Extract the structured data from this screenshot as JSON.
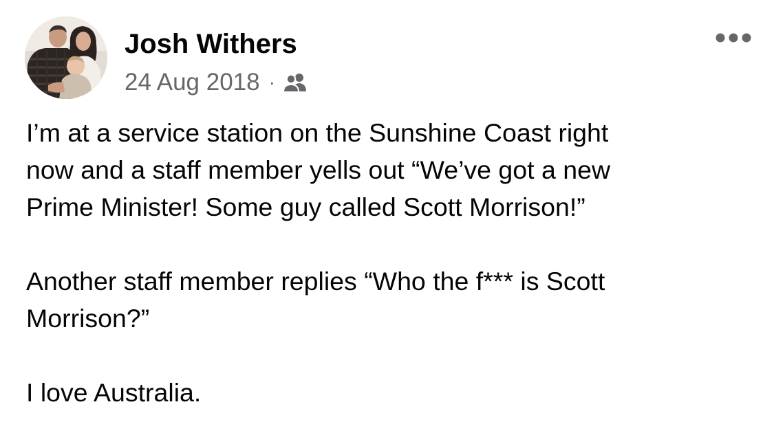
{
  "post": {
    "author": {
      "name": "Josh Withers",
      "avatar_icon": "family-photo-avatar"
    },
    "date": "24 Aug 2018",
    "separator": "·",
    "audience_icon": "friends-icon",
    "more_options_icon": "more-options-icon",
    "paragraphs": [
      "I’m at a service station on the Sunshine Coast right\nnow and a staff member yells out “We’ve got a new\nPrime Minister! Some guy called Scott Morrison!”",
      "Another staff member replies “Who the f*** is Scott\nMorrison?”",
      "I love Australia."
    ]
  },
  "colors": {
    "text_primary": "#050505",
    "text_secondary": "#65676b"
  }
}
